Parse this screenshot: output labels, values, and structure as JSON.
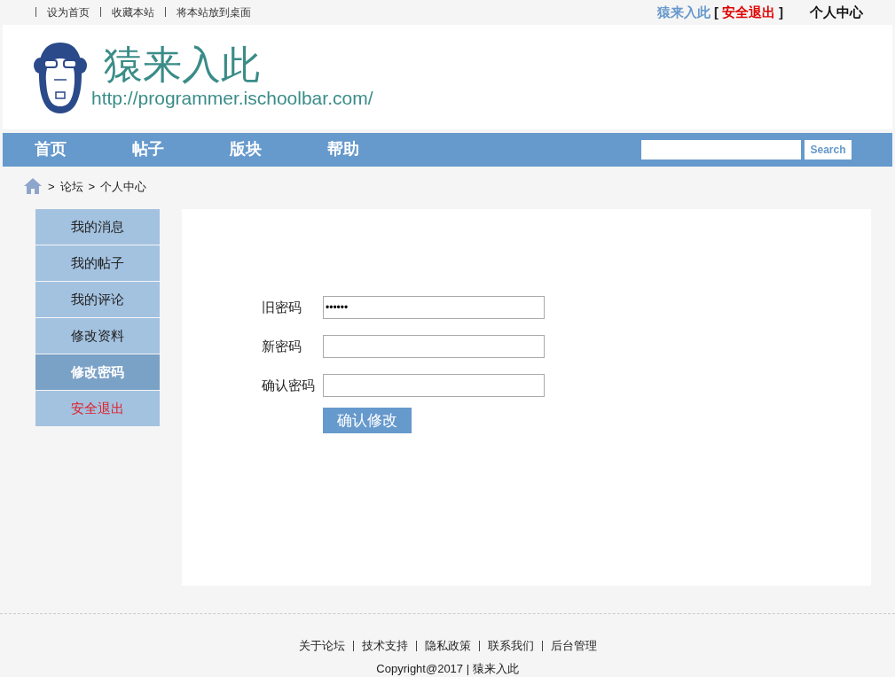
{
  "top_links": [
    "设为首页",
    "收藏本站",
    "将本站放到桌面"
  ],
  "user": {
    "name": "猿来入此",
    "logout": "安全退出",
    "bracket_open": "[",
    "bracket_close": "]",
    "center": "个人中心"
  },
  "logo": {
    "title": "猿来入此",
    "url": "http://programmer.ischoolbar.com/"
  },
  "nav": [
    "首页",
    "帖子",
    "版块",
    "帮助"
  ],
  "search": {
    "button": "Search"
  },
  "breadcrumb": [
    ">",
    "论坛",
    ">",
    "个人中心"
  ],
  "sidebar": [
    {
      "label": "我的消息",
      "selected": false,
      "kind": "link"
    },
    {
      "label": "我的帖子",
      "selected": false,
      "kind": "link"
    },
    {
      "label": "我的评论",
      "selected": false,
      "kind": "link"
    },
    {
      "label": "修改资料",
      "selected": false,
      "kind": "link"
    },
    {
      "label": "修改密码",
      "selected": true,
      "kind": "link"
    },
    {
      "label": "安全退出",
      "selected": false,
      "kind": "logout"
    }
  ],
  "form": {
    "fields": [
      {
        "label": "旧密码",
        "value": "••••••"
      },
      {
        "label": "新密码"
      },
      {
        "label": "确认密码"
      }
    ],
    "submit": "确认修改"
  },
  "footer": {
    "links": [
      "关于论坛",
      "技术支持",
      "隐私政策",
      "联系我们",
      "后台管理"
    ],
    "copyright": "Copyright@2017 | 猿来入此"
  }
}
